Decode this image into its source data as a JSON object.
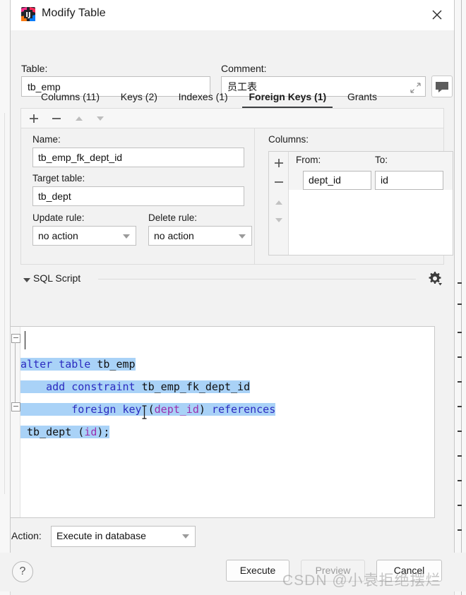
{
  "window": {
    "title": "Modify Table",
    "app_icon": "intellij-idea-icon",
    "close_icon": "close-icon"
  },
  "top_form": {
    "table_label": "Table:",
    "table_value": "tb_emp",
    "comment_label": "Comment:",
    "comment_value": "员工表",
    "expand_icon": "expand-icon",
    "comment_button_icon": "comment-bubble-icon"
  },
  "tabs": [
    {
      "label": "Columns (11)",
      "active": false
    },
    {
      "label": "Keys (2)",
      "active": false
    },
    {
      "label": "Indexes (1)",
      "active": false
    },
    {
      "label": "Foreign Keys (1)",
      "active": true
    },
    {
      "label": "Grants",
      "active": false
    }
  ],
  "toolbar": {
    "add_icon": "plus-icon",
    "remove_icon": "minus-icon",
    "move_up_icon": "triangle-up-icon",
    "move_down_icon": "triangle-down-icon"
  },
  "fk_editor": {
    "name_label": "Name:",
    "name_value": "tb_emp_fk_dept_id",
    "target_table_label": "Target table:",
    "target_table_value": "tb_dept",
    "update_rule_label": "Update rule:",
    "update_rule_value": "no action",
    "delete_rule_label": "Delete rule:",
    "delete_rule_value": "no action",
    "columns_label": "Columns:",
    "columns_from_header": "From:",
    "columns_to_header": "To:",
    "columns_rows": [
      {
        "from": "dept_id",
        "to": "id"
      }
    ],
    "columns_add_icon": "plus-icon",
    "columns_remove_icon": "minus-icon",
    "columns_up_icon": "triangle-up-icon",
    "columns_down_icon": "triangle-down-icon"
  },
  "sql_script": {
    "section_title": "SQL Script",
    "collapse_icon": "triangle-down-icon",
    "settings_icon": "gear-icon",
    "lines": [
      {
        "tokens": [
          {
            "t": "alter table ",
            "c": "kw"
          },
          {
            "t": "tb_emp",
            "c": "id"
          }
        ]
      },
      {
        "tokens": [
          {
            "t": "    add constraint ",
            "c": "kw"
          },
          {
            "t": "tb_emp_fk_dept_id",
            "c": "id"
          }
        ]
      },
      {
        "tokens": [
          {
            "t": "        foreign key ",
            "c": "kw"
          },
          {
            "t": "(",
            "c": "id"
          },
          {
            "t": "dept_id",
            "c": "col"
          },
          {
            "t": ") ",
            "c": "id"
          },
          {
            "t": "references",
            "c": "kw"
          }
        ]
      },
      {
        "tokens": [
          {
            "t": " tb_dept ",
            "c": "id"
          },
          {
            "t": "(",
            "c": "id"
          },
          {
            "t": "id",
            "c": "col"
          },
          {
            "t": ");",
            "c": "id"
          }
        ]
      }
    ],
    "plain_text": "alter table tb_emp\n    add constraint tb_emp_fk_dept_id\n        foreign key (dept_id) references tb_dept (id);"
  },
  "action_bar": {
    "action_label": "Action:",
    "action_value": "Execute in database",
    "help_label": "?",
    "buttons": [
      {
        "label": "Execute",
        "enabled": true
      },
      {
        "label": "Preview",
        "enabled": false
      },
      {
        "label": "Cancel",
        "enabled": true
      }
    ]
  },
  "watermark": {
    "text": "CSDN @小袁拒绝摆烂"
  },
  "colors": {
    "dialog_bg": "#f2f2f2",
    "field_bg": "#ffffff",
    "selection": "#a9d2f7",
    "keyword": "#2b2bc0",
    "column_token": "#9b2fae",
    "active_tab_underline": "#3c3f41"
  }
}
